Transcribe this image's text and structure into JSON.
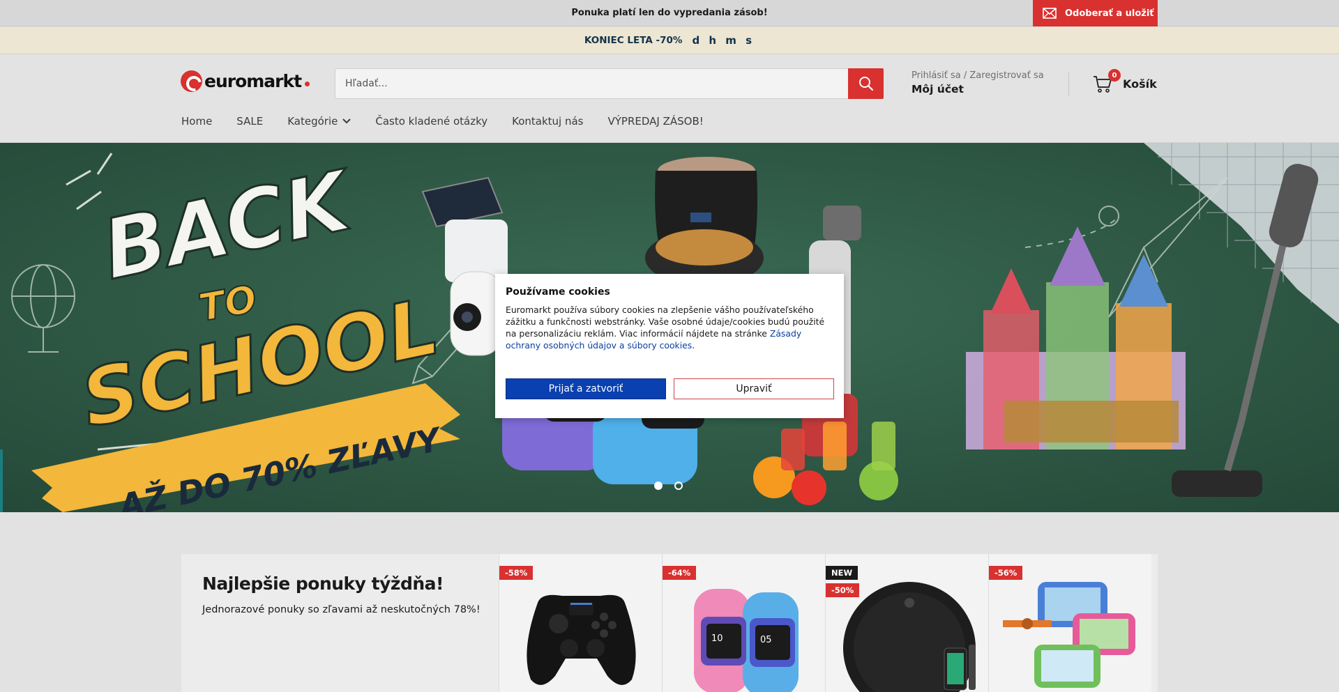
{
  "topbar": {
    "message": "Ponuka platí len do vypredania zásob!",
    "subscribe_label": "Odoberať a uložiť"
  },
  "countdown": {
    "label": "KONIEC LETA -70%",
    "units": "d h m s"
  },
  "header": {
    "logo_text": "euromarkt",
    "search_placeholder": "Hľadať...",
    "account_links": "Prihlásiť sa / Zaregistrovať sa",
    "account_title": "Môj účet",
    "cart_count": "0",
    "cart_label": "Košík"
  },
  "nav": {
    "items": [
      {
        "label": "Home"
      },
      {
        "label": "SALE"
      },
      {
        "label": "Kategórie"
      },
      {
        "label": "Často kladené otázky"
      },
      {
        "label": "Kontaktuj nás"
      },
      {
        "label": "VÝPREDAJ ZÁSOB!"
      }
    ]
  },
  "hero": {
    "line1": "BACK",
    "line2": "TO",
    "line3": "SCHOOL",
    "banner": "AŽ DO 70% ZĽAVY",
    "slides": 2,
    "active_slide": 1
  },
  "cookie": {
    "title": "Používame cookies",
    "text": "Euromarkt používa súbory cookies na zlepšenie vášho používateľského zážitku a funkčnosti webstránky. Vaše osobné údaje/cookies budú použité na personalizáciu reklám. Viac informácií nájdete na stránke ",
    "link": "Zásady ochrany osobných údajov a súbory cookies",
    "accept": "Prijať a zatvoriť",
    "edit": "Upraviť"
  },
  "deals": {
    "title": "Najlepšie ponuky týždňa!",
    "subtitle": "Jednorazové ponuky so zľavami až neskutočných 78%!",
    "products": [
      {
        "badges": [
          "-58%"
        ],
        "icon": "gamepad-icon"
      },
      {
        "badges": [
          "-64%"
        ],
        "icon": "smartwatch-icon"
      },
      {
        "badges": [
          "NEW",
          "-50%"
        ],
        "icon": "robot-vacuum-icon"
      },
      {
        "badges": [
          "-56%"
        ],
        "icon": "kids-tablet-icon"
      }
    ]
  },
  "colors": {
    "brand_red": "#d8312f",
    "accept_blue": "#0a40b0",
    "hero_green": "#2e5a45",
    "yellow": "#f2b73b"
  }
}
